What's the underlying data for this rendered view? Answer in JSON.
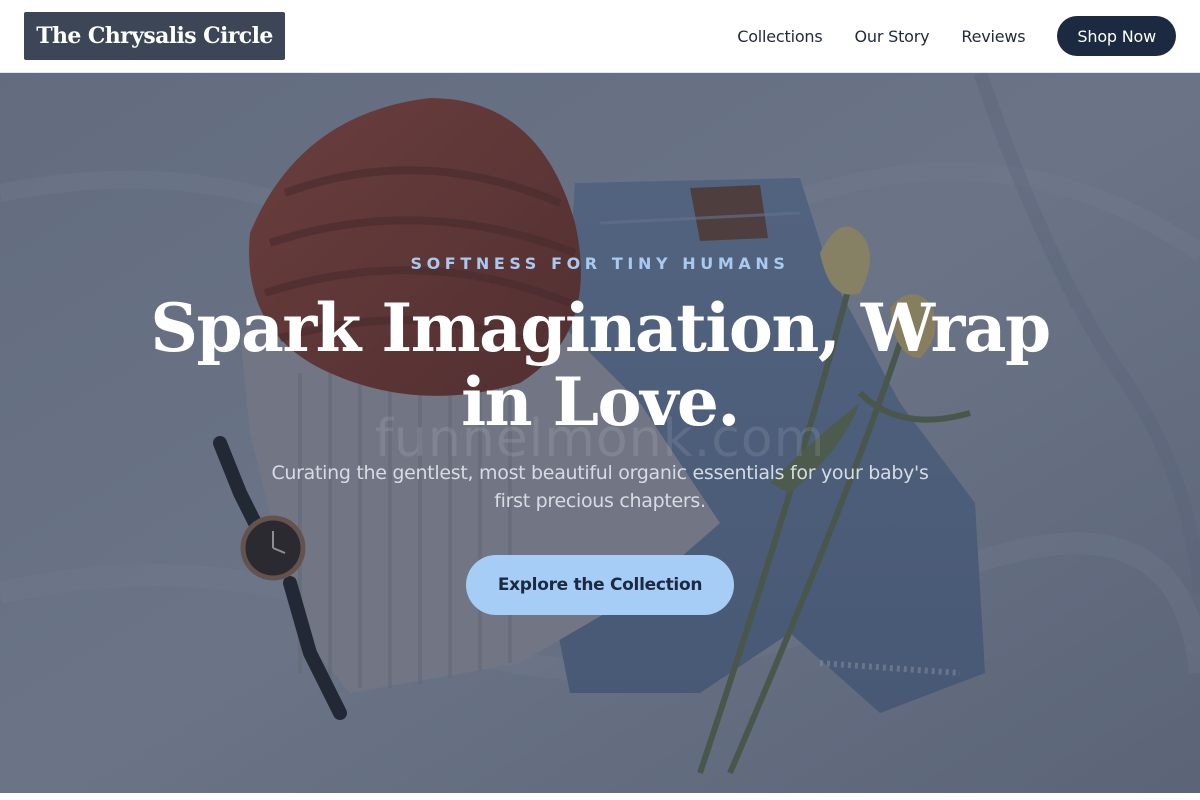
{
  "header": {
    "logo_text": "The Chrysalis Circle",
    "nav": {
      "collections": "Collections",
      "our_story": "Our Story",
      "reviews": "Reviews"
    },
    "shop_button": "Shop Now"
  },
  "hero": {
    "eyebrow": "SOFTNESS FOR TINY HUMANS",
    "headline": "Spark Imagination, Wrap in Love.",
    "subtext": "Curating the gentlest, most beautiful organic essentials for your baby's first precious chapters.",
    "cta_label": "Explore the Collection",
    "watermark": "funnelmonk.com"
  },
  "colors": {
    "logo_bg": "#3c4656",
    "shop_button_bg": "#1b2a40",
    "eyebrow": "#a9c9ee",
    "cta_bg": "#a6cdf5"
  },
  "hero_image": {
    "items": [
      "knit-beanie-icon",
      "sweater-icon",
      "jeans-icon",
      "wristwatch-icon",
      "tulip-icon"
    ]
  }
}
